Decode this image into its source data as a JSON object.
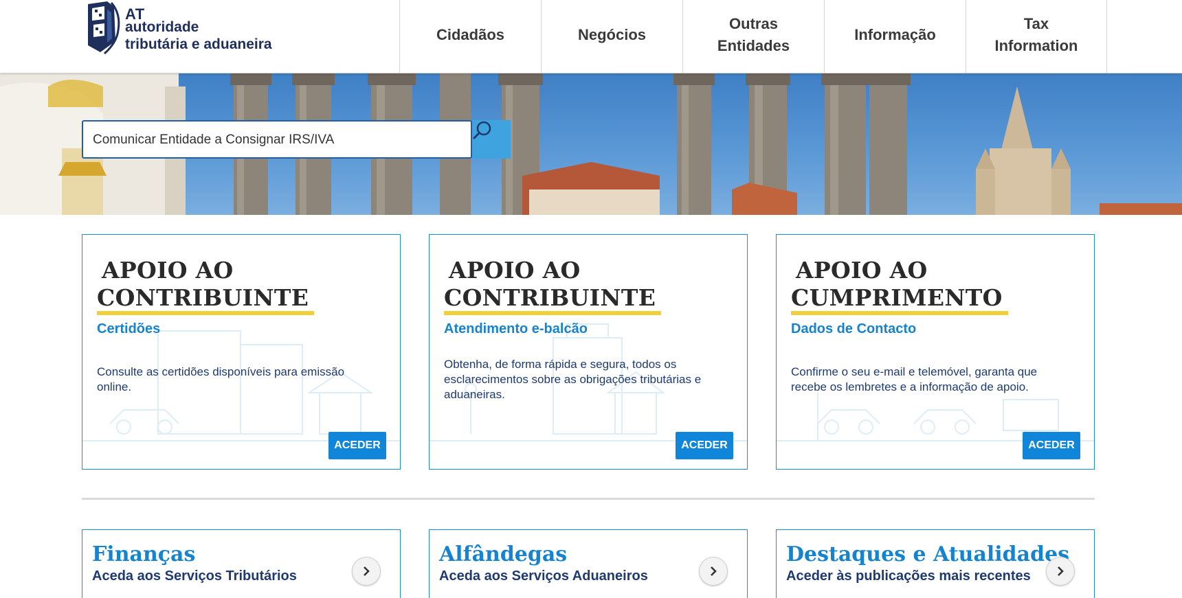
{
  "brand": {
    "logo_at": "AT",
    "logo_line1": "autoridade",
    "logo_line2": "tributária e aduaneira"
  },
  "nav": {
    "items": [
      {
        "label": "Cidadãos"
      },
      {
        "label": "Negócios"
      },
      {
        "label": "Outras Entidades"
      },
      {
        "label": "Informação"
      },
      {
        "label": "Tax Information"
      }
    ]
  },
  "search": {
    "value": "Comunicar Entidade a Consignar IRS/IVA",
    "icon": "search-icon"
  },
  "cards": [
    {
      "heading_line1": "APOIO AO",
      "heading_line2": "CONTRIBUINTE",
      "subtitle": "Certidões",
      "description": "Consulte as certidões disponíveis para emissão online.",
      "button": "ACEDER"
    },
    {
      "heading_line1": "APOIO AO",
      "heading_line2": "CONTRIBUINTE",
      "subtitle": "Atendimento e-balcão",
      "description": "Obtenha, de forma rápida e segura, todos os esclarecimentos sobre as obrigações tributárias e aduaneiras.",
      "button": "ACEDER"
    },
    {
      "heading_line1": "APOIO AO",
      "heading_line2": "CUMPRIMENTO",
      "subtitle": "Dados de Contacto",
      "description": "Confirme o seu e-mail e telemóvel, garanta que recebe os lembretes e a informação de apoio.",
      "button": "ACEDER"
    }
  ],
  "tiles": [
    {
      "title": "Finanças",
      "subtitle": "Aceda aos Serviços Tributários",
      "icon": "chevron-right-icon"
    },
    {
      "title": "Alfândegas",
      "subtitle": "Aceda aos Serviços Aduaneiros",
      "icon": "chevron-right-icon"
    },
    {
      "title": "Destaques e Atualidades",
      "subtitle": "Aceder às publicações mais recentes",
      "icon": "chevron-right-icon"
    }
  ],
  "colors": {
    "accent_blue": "#1683cf",
    "button_blue": "#0f86d9",
    "highlight_yellow": "#f0cf3a",
    "navy": "#1e3a6e"
  }
}
